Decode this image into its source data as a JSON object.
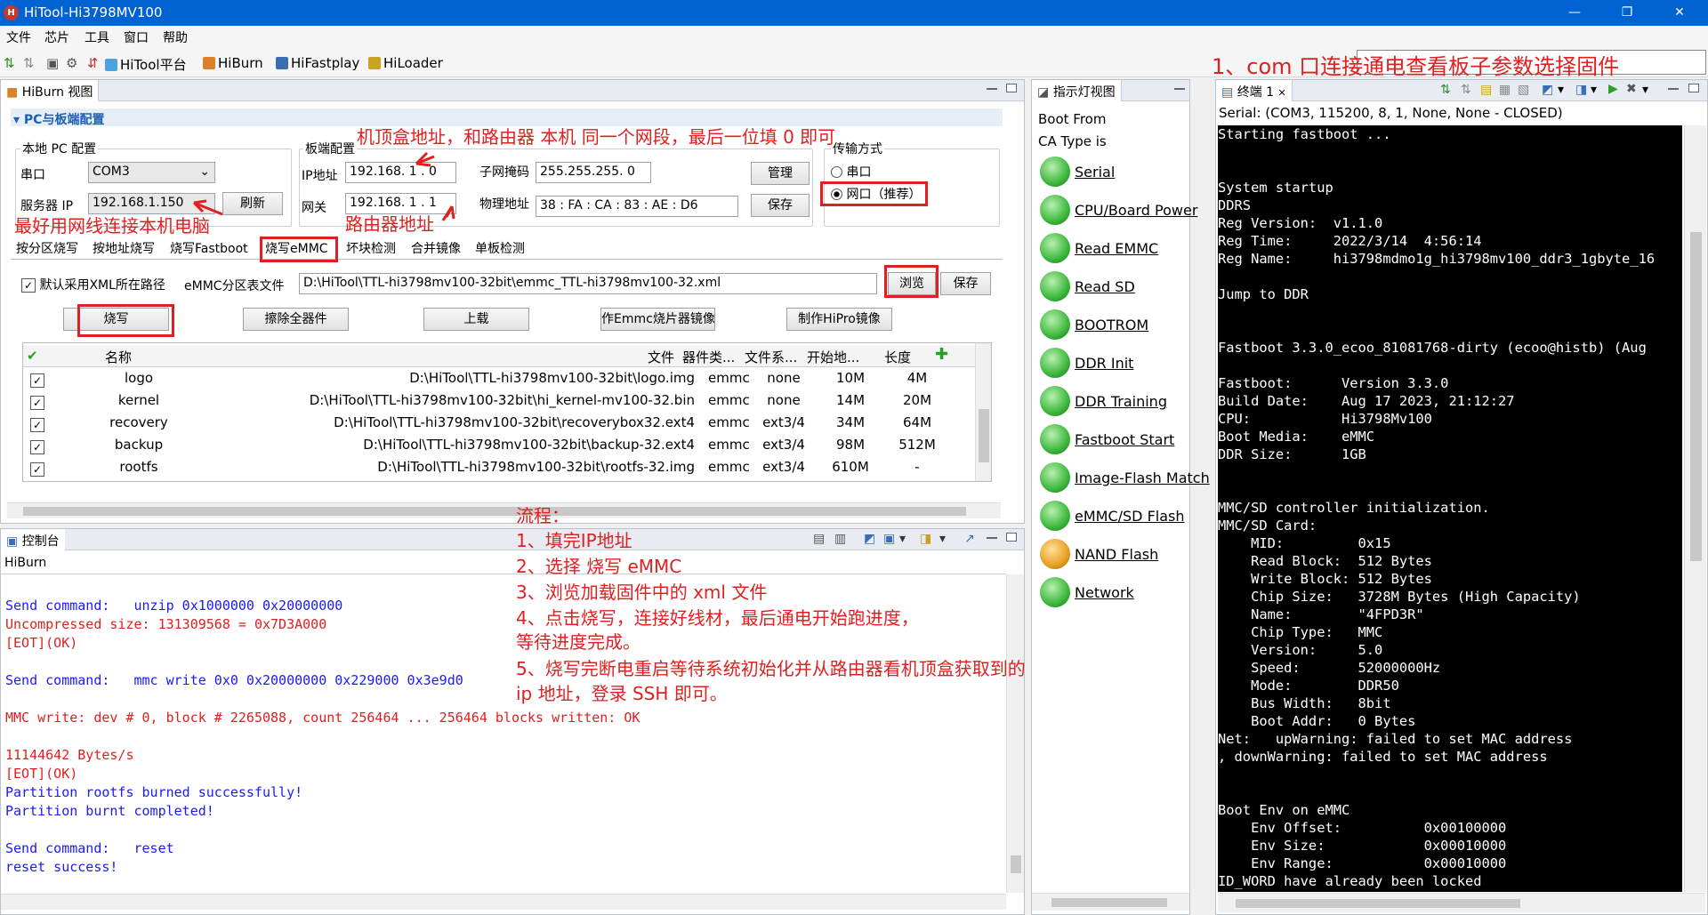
{
  "window": {
    "title": "HiTool-Hi3798MV100",
    "app_icon": "hitool-logo-icon"
  },
  "menu": [
    "文件",
    "芯片",
    "工具",
    "窗口",
    "帮助"
  ],
  "toolbar": [
    "HiTool平台",
    "HiBurn",
    "HiFastplay",
    "HiLoader"
  ],
  "hiburn": {
    "view_title": "HiBurn 视图",
    "section_title": "PC与板端配置",
    "local_pc": {
      "title": "本地 PC 配置",
      "serial_label": "串口",
      "serial_value": "COM3",
      "server_ip_label": "服务器 IP",
      "server_ip_value": "192.168.1.150",
      "refresh": "刷新"
    },
    "board": {
      "title": "板端配置",
      "ip_label": "IP地址",
      "ip_value": "192.168. 1 . 0",
      "gateway_label": "网关",
      "gateway_value": "192.168. 1 . 1",
      "mask_label": "子网掩码",
      "mask_value": "255.255.255. 0",
      "mac_label": "物理地址",
      "mac_value": "38 : FA : CA : 83 : AE : D6",
      "manage": "管理",
      "save": "保存"
    },
    "transfer": {
      "title": "传输方式",
      "serial": "串口",
      "network": "网口（推荐）"
    },
    "tabs": [
      "按分区烧写",
      "按地址烧写",
      "烧写Fastboot",
      "烧写eMMC",
      "坏块检测",
      "合并镜像",
      "单板检测"
    ],
    "xml_checkbox": "默认采用XML所在路径",
    "emmc_label": "eMMC分区表文件",
    "emmc_path": "D:\\HiTool\\TTL-hi3798mv100-32bit\\emmc_TTL-hi3798mv100-32.xml",
    "browse": "浏览",
    "save": "保存",
    "actions": [
      "烧写",
      "擦除全器件",
      "上载",
      "作Emmc烧片器镜像",
      "制作HiPro镜像"
    ],
    "columns": [
      "名称",
      "文件",
      "器件类...",
      "文件系...",
      "开始地...",
      "长度"
    ],
    "rows": [
      {
        "name": "logo",
        "file": "D:\\HiTool\\TTL-hi3798mv100-32bit\\logo.img",
        "type": "emmc",
        "fs": "none",
        "start": "10M",
        "len": "4M"
      },
      {
        "name": "kernel",
        "file": "D:\\HiTool\\TTL-hi3798mv100-32bit\\hi_kernel-mv100-32.bin",
        "type": "emmc",
        "fs": "none",
        "start": "14M",
        "len": "20M"
      },
      {
        "name": "recovery",
        "file": "D:\\HiTool\\TTL-hi3798mv100-32bit\\recoverybox32.ext4",
        "type": "emmc",
        "fs": "ext3/4",
        "start": "34M",
        "len": "64M"
      },
      {
        "name": "backup",
        "file": "D:\\HiTool\\TTL-hi3798mv100-32bit\\backup-32.ext4",
        "type": "emmc",
        "fs": "ext3/4",
        "start": "98M",
        "len": "512M"
      },
      {
        "name": "rootfs",
        "file": "D:\\HiTool\\TTL-hi3798mv100-32bit\\rootfs-32.img",
        "type": "emmc",
        "fs": "ext3/4",
        "start": "610M",
        "len": "-"
      }
    ]
  },
  "console_panel": {
    "title": "控制台",
    "sub": "HiBurn",
    "lines": [
      {
        "t": "",
        "c": "blue"
      },
      {
        "t": "Send command:   unzip 0x1000000 0x20000000",
        "c": "blue"
      },
      {
        "t": "Uncompressed size: 131309568 = 0x7D3A000",
        "c": "cred"
      },
      {
        "t": "[EOT](OK)",
        "c": "cred"
      },
      {
        "t": "",
        "c": "blue"
      },
      {
        "t": "Send command:   mmc write 0x0 0x20000000 0x229000 0x3e9d0",
        "c": "blue"
      },
      {
        "t": "",
        "c": "blue"
      },
      {
        "t": "MMC write: dev # 0, block # 2265088, count 256464 ... 256464 blocks written: OK",
        "c": "cred"
      },
      {
        "t": "",
        "c": "blue"
      },
      {
        "t": "11144642 Bytes/s",
        "c": "cred"
      },
      {
        "t": "[EOT](OK)",
        "c": "cred"
      },
      {
        "t": "Partition rootfs burned successfully!",
        "c": "blue"
      },
      {
        "t": "Partition burnt completed!",
        "c": "blue"
      },
      {
        "t": "",
        "c": "blue"
      },
      {
        "t": "Send command:   reset",
        "c": "blue"
      },
      {
        "t": "reset success!",
        "c": "blue"
      }
    ]
  },
  "indicator": {
    "title": "指示灯视图",
    "boot_from": "Boot From",
    "ca_type": "CA Type is",
    "items": [
      {
        "label": "Serial",
        "color": "green"
      },
      {
        "label": "CPU/Board Power",
        "color": "green"
      },
      {
        "label": "Read EMMC",
        "color": "green"
      },
      {
        "label": "Read SD ",
        "color": "green"
      },
      {
        "label": "BOOTROM",
        "color": "green"
      },
      {
        "label": "DDR Init",
        "color": "green"
      },
      {
        "label": "DDR Training",
        "color": "green"
      },
      {
        "label": "Fastboot Start",
        "color": "green"
      },
      {
        "label": "Image-Flash Match",
        "color": "green"
      },
      {
        "label": "eMMC/SD Flash",
        "color": "green"
      },
      {
        "label": "NAND Flash",
        "color": "orange"
      },
      {
        "label": "Network",
        "color": "green"
      }
    ]
  },
  "terminal": {
    "title": "终端 1",
    "serial_info": "Serial: (COM3, 115200, 8, 1, None, None - CLOSED)",
    "text": "Starting fastboot ...\n\n\nSystem startup\nDDRS\nReg Version:  v1.1.0\nReg Time:     2022/3/14  4:56:14\nReg Name:     hi3798mdmo1g_hi3798mv100_ddr3_1gbyte_16\n\nJump to DDR\n\n\nFastboot 3.3.0_ecoo_81081768-dirty (ecoo@histb) (Aug\n\nFastboot:      Version 3.3.0\nBuild Date:    Aug 17 2023, 21:12:27\nCPU:           Hi3798Mv100\nBoot Media:    eMMC\nDDR Size:      1GB\n\n\nMMC/SD controller initialization.\nMMC/SD Card:\n    MID:         0x15\n    Read Block:  512 Bytes\n    Write Block: 512 Bytes\n    Chip Size:   3728M Bytes (High Capacity)\n    Name:        \"4FPD3R\"\n    Chip Type:   MMC\n    Version:     5.0\n    Speed:       52000000Hz\n    Mode:        DDR50\n    Bus Width:   8bit\n    Boot Addr:   0 Bytes\nNet:   upWarning: failed to set MAC address\n, downWarning: failed to set MAC address\n\n\nBoot Env on eMMC\n    Env Offset:          0x00100000\n    Env Size:            0x00010000\n    Env Range:           0x00010000\nID_WORD have already been locked"
  },
  "annotations": {
    "top_right": "1、com 口连接通电查看板子参数选择固件",
    "ip_note": "机顶盒地址，和路由器 本机 同一个网段，最后一位填 0 即可",
    "cable_note": "最好用网线连接本机电脑",
    "router_note": "路由器地址",
    "flow_title": "流程：",
    "flow": [
      "1、填完IP地址",
      "2、选择 烧写 eMMC",
      "3、浏览加载固件中的 xml 文件",
      "4、点击烧写，连接好线材，最后通电开始跑进度，",
      "      等待进度完成。",
      "5、烧写完断电重启等待系统初始化并从路由器看机顶盒获取到的",
      "      ip 地址，登录 SSH 即可。"
    ]
  }
}
